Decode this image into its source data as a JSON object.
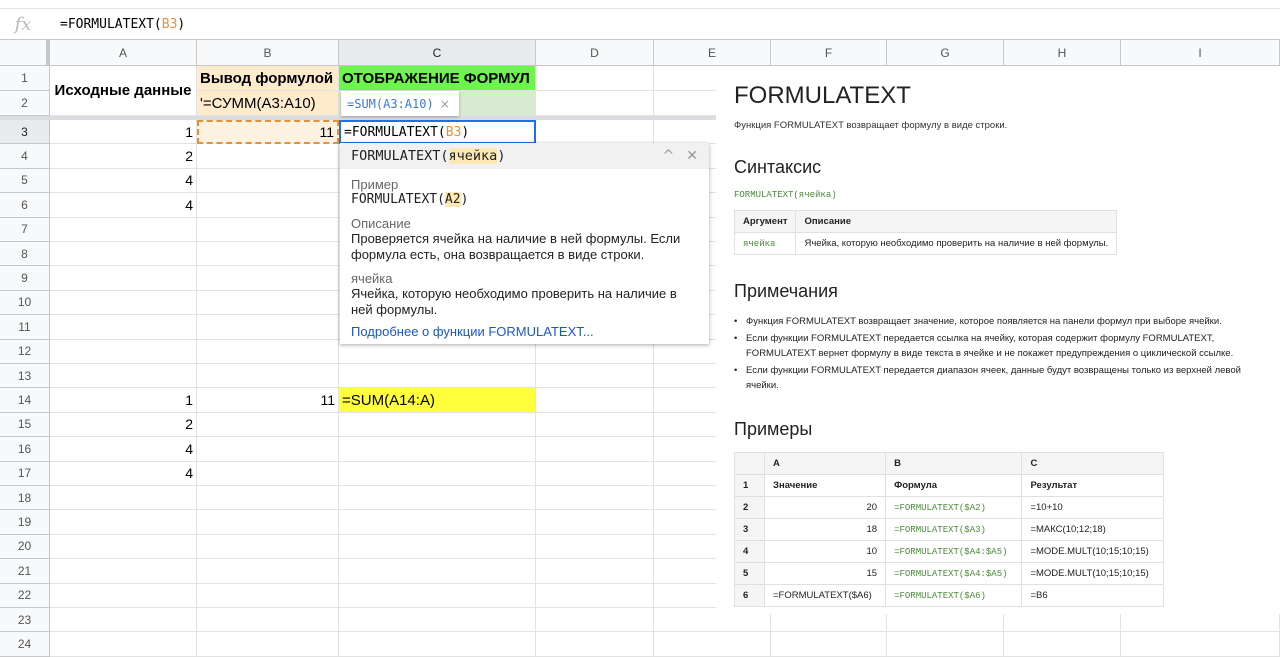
{
  "formula_bar": {
    "icon": "fx-icon",
    "prefix": "=FORMULATEXT(",
    "ref": "B3",
    "suffix": ")"
  },
  "columns": [
    "A",
    "B",
    "C",
    "D",
    "E",
    "F",
    "G",
    "H",
    "I"
  ],
  "row_count": 24,
  "cells": {
    "A1": "Исходные данные",
    "B1": "Вывод формулой",
    "C1": "ОТОБРАЖЕНИЕ ФОРМУЛ",
    "B2": "'=СУММ(A3:A10)",
    "A3": "1",
    "B3": "11",
    "A4": "2",
    "A5": "4",
    "A6": "4",
    "A14": "1",
    "B14": "11",
    "C14": "=SUM(A14:A)",
    "A15": "2",
    "A16": "4",
    "A17": "4"
  },
  "editor": {
    "prefix": "=FORMULATEXT(",
    "ref": "B3",
    "suffix": ")"
  },
  "chip": {
    "text": "=SUM(A3:A10)",
    "close": "×"
  },
  "colors": {
    "b_fill": "#fdebcb",
    "c1_fill": "#6cf54a",
    "c2_fill": "#d9ead3",
    "c14_fill": "#ffff3c",
    "accent": "#1a73e8",
    "ref": "#e69138"
  },
  "popup": {
    "sig_prefix": "FORMULATEXT(",
    "sig_arg": "ячейка",
    "sig_suffix": ")",
    "example_label": "Пример",
    "ex_prefix": "FORMULATEXT(",
    "ex_arg": "A2",
    "ex_suffix": ")",
    "desc_label": "Описание",
    "desc": "Проверяется ячейка на наличие в ней формулы. Если формула есть, она возвращается в виде строки.",
    "arg_label": "ячейка",
    "arg_desc": "Ячейка, которую необходимо проверить на наличие в ней формулы.",
    "link": "Подробнее о функции FORMULATEXT...",
    "collapse": "^",
    "close": "✕"
  },
  "help": {
    "title": "FORMULATEXT",
    "intro": "Функция FORMULATEXT возвращает формулу в виде строки.",
    "syntax_h": "Синтаксис",
    "syntax": "FORMULATEXT(ячейка)",
    "syn_headers": [
      "Аргумент",
      "Описание"
    ],
    "syn_row": [
      "ячейка",
      "Ячейка, которую необходимо проверить на наличие в ней формулы."
    ],
    "notes_h": "Примечания",
    "notes": [
      "Функция FORMULATEXT возвращает значение, которое появляется на панели формул при выборе ячейки.",
      "Если функции FORMULATEXT передается ссылка на ячейку, которая содержит формулу FORMULATEXT, FORMULATEXT вернет формулу в виде текста в ячейке и не покажет предупреждения о циклической ссылке.",
      "Если функции FORMULATEXT передается диапазон ячеек, данные будут возвращены только из верхней левой ячейки."
    ],
    "examples_h": "Примеры",
    "ex_headers": [
      "",
      "A",
      "B",
      "C"
    ],
    "ex_rows": [
      [
        "1",
        "Значение",
        "Формула",
        "Результат"
      ],
      [
        "2",
        "20",
        "=FORMULATEXT($A2)",
        "=10+10"
      ],
      [
        "3",
        "18",
        "=FORMULATEXT($A3)",
        "=МАКС(10;12;18)"
      ],
      [
        "4",
        "10",
        "=FORMULATEXT($A4:$A5)",
        "=MODE.MULT(10;15;10;15)"
      ],
      [
        "5",
        "15",
        "=FORMULATEXT($A4:$A5)",
        "=MODE.MULT(10;15;10;15)"
      ],
      [
        "6",
        "=FORMULATEXT($A6)",
        "=FORMULATEXT($A6)",
        "=B6"
      ]
    ]
  }
}
